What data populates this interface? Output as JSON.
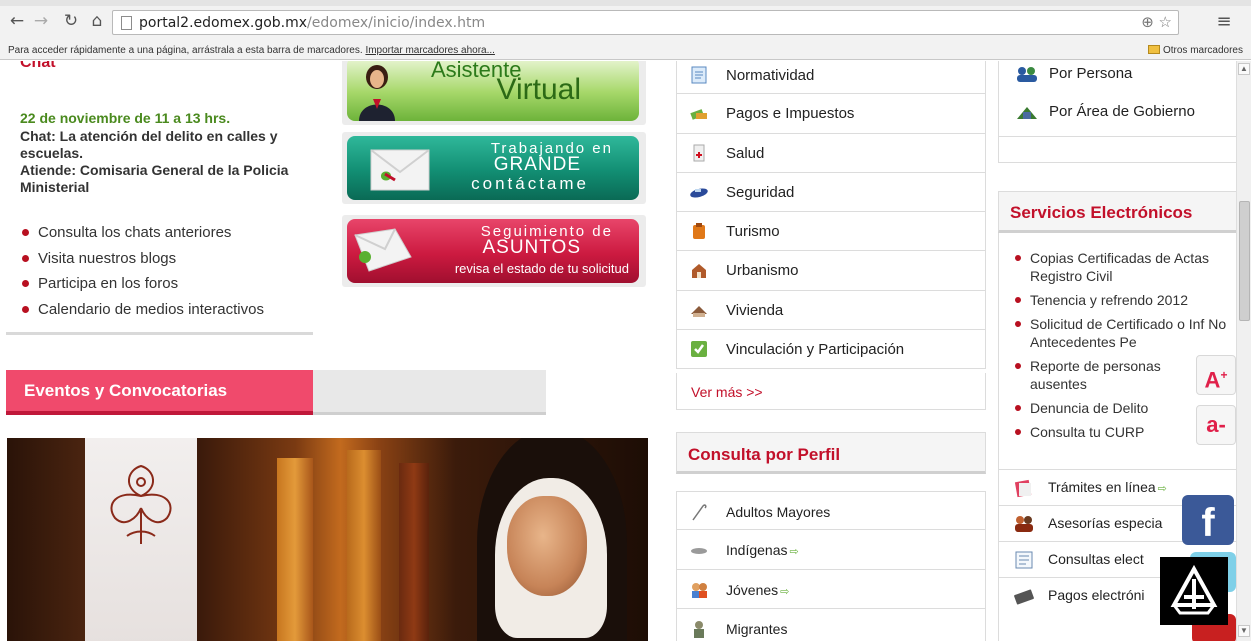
{
  "browser": {
    "url_host": "portal2.edomex.gob.mx",
    "url_path": "/edomex/inicio/index.htm",
    "bookmarks_hint": "Para acceder rápidamente a una página, arrástrala a esta barra de marcadores.",
    "bookmarks_import": "Importar marcadores ahora...",
    "other_bookmarks": "Otros marcadores"
  },
  "chat": {
    "title": "Chat",
    "date": "22 de noviembre de 11 a 13 hrs.",
    "description": "Chat: La atención del delito en calles y escuelas.\nAtiende: Comisaria General de la Policia Ministerial",
    "links": [
      "Consulta los chats anteriores",
      "Visita nuestros blogs",
      "Participa en los foros",
      "Calendario de medios interactivos"
    ]
  },
  "events": {
    "title": "Eventos y Convocatorias"
  },
  "banners": {
    "asistente": {
      "line1": "Asistente",
      "line2": "Virtual"
    },
    "contacto": {
      "line1": "Trabajando en",
      "line2": "GRANDE",
      "line3": "contáctame"
    },
    "seguimiento": {
      "line1": "Seguimiento de",
      "line2": "ASUNTOS",
      "line3": "revisa el estado de tu solicitud"
    }
  },
  "topics": {
    "items": [
      {
        "label": "Normatividad",
        "icon": "document-icon"
      },
      {
        "label": "Pagos e Impuestos",
        "icon": "money-icon"
      },
      {
        "label": "Salud",
        "icon": "health-icon"
      },
      {
        "label": "Seguridad",
        "icon": "security-icon"
      },
      {
        "label": "Turismo",
        "icon": "tourism-icon"
      },
      {
        "label": "Urbanismo",
        "icon": "urbanism-icon"
      },
      {
        "label": "Vivienda",
        "icon": "house-icon"
      },
      {
        "label": "Vinculación y Participación",
        "icon": "participation-icon"
      }
    ],
    "more": "Ver más >>"
  },
  "perfil": {
    "title": "Consulta por Perfil",
    "items": [
      {
        "label": "Adultos Mayores",
        "icon": "cane-icon",
        "external": false
      },
      {
        "label": "Indígenas",
        "icon": "feather-icon",
        "external": true
      },
      {
        "label": "Jóvenes",
        "icon": "youth-icon",
        "external": true
      },
      {
        "label": "Migrantes",
        "icon": "migrant-icon",
        "external": false
      }
    ]
  },
  "right": {
    "items": [
      {
        "label": "Por Persona",
        "icon": "people-icon"
      },
      {
        "label": "Por Área de Gobierno",
        "icon": "government-icon"
      }
    ]
  },
  "servicios": {
    "title": "Servicios Electrónicos",
    "list": [
      "Copias Certificadas de Actas Registro Civil",
      "Tenencia y refrendo 2012",
      "Solicitud de Certificado o Inf No Antecedentes Pe",
      "Reporte de personas ausentes",
      "Denuncia de Delito",
      "Consulta tu CURP"
    ],
    "icon_items": [
      {
        "label": "Trámites en línea",
        "icon": "forms-icon"
      },
      {
        "label": "Asesorías especia",
        "icon": "advisors-icon"
      },
      {
        "label": "Consultas elect",
        "icon": "consults-icon"
      },
      {
        "label": "Pagos electróni",
        "icon": "card-icon"
      }
    ]
  },
  "widgets": {
    "font_increase": "A",
    "font_increase_sup": "+",
    "font_decrease": "a-",
    "facebook": "f"
  },
  "colors": {
    "accent_red": "#c2102a",
    "events_pink": "#f04a6c",
    "chat_date_green": "#4a8a1e"
  }
}
